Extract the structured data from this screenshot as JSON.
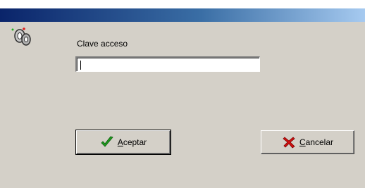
{
  "dialog": {
    "field_label": "Clave acceso",
    "password_value": ""
  },
  "buttons": {
    "accept": {
      "mnemonic": "A",
      "rest": "ceptar"
    },
    "cancel": {
      "mnemonic": "C",
      "rest": "ancelar"
    }
  },
  "icons": {
    "dialog_icon": "key-icon",
    "accept_icon": "check-icon",
    "cancel_icon": "x-icon"
  },
  "colors": {
    "title_gradient_start": "#0a246a",
    "title_gradient_end": "#a6caf0",
    "face": "#d4d0c8",
    "check_green": "#1e9b1e",
    "cancel_red": "#d01010"
  }
}
